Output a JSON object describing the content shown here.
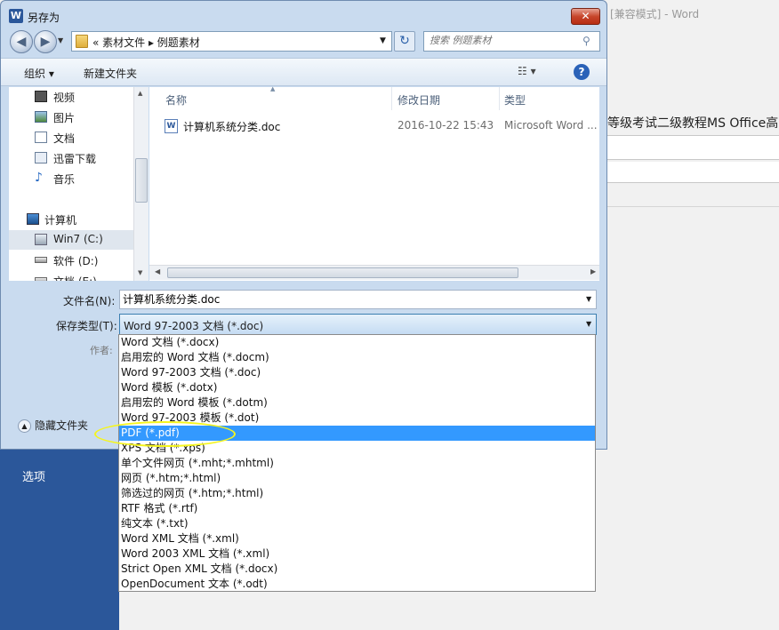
{
  "background_window": {
    "title": "[兼容模式] - Word",
    "doc_text": "等级考试二级教程MS Office高",
    "side_panel_label": "选项"
  },
  "dialog": {
    "title": "另存为",
    "app_icon_letter": "W",
    "close_glyph": "✕",
    "address": {
      "text": "«  素材文件  ▸  例题素材"
    },
    "search": {
      "placeholder": "搜索 例题素材"
    },
    "toolbar": {
      "organize": "组织 ▾",
      "new_folder": "新建文件夹",
      "view": "☷  ▾",
      "help": "?"
    },
    "nav_pane": {
      "items": [
        {
          "label": "视频",
          "icon": "video-icon"
        },
        {
          "label": "图片",
          "icon": "picture-icon"
        },
        {
          "label": "文档",
          "icon": "document-icon"
        },
        {
          "label": "迅雷下载",
          "icon": "download-icon"
        },
        {
          "label": "音乐",
          "icon": "music-icon"
        },
        {
          "label": "计算机",
          "icon": "computer-icon"
        },
        {
          "label": "Win7 (C:)",
          "icon": "drive-icon"
        },
        {
          "label": "软件 (D:)",
          "icon": "drive-icon"
        },
        {
          "label": "文档 (E:)",
          "icon": "drive-icon"
        }
      ]
    },
    "file_list": {
      "columns": [
        "名称",
        "修改日期",
        "类型"
      ],
      "rows": [
        {
          "name": "计算机系统分类.doc",
          "date": "2016-10-22 15:43",
          "type": "Microsoft Word ..."
        }
      ]
    },
    "filename": {
      "label": "文件名(N):",
      "value": "计算机系统分类.doc"
    },
    "filetype": {
      "label": "保存类型(T):",
      "selected": "Word 97-2003 文档 (*.doc)",
      "options": [
        "Word 文档 (*.docx)",
        "启用宏的 Word 文档 (*.docm)",
        "Word 97-2003 文档 (*.doc)",
        "Word 模板 (*.dotx)",
        "启用宏的 Word 模板 (*.dotm)",
        "Word 97-2003 模板 (*.dot)",
        "PDF (*.pdf)",
        "XPS 文档 (*.xps)",
        "单个文件网页 (*.mht;*.mhtml)",
        "网页 (*.htm;*.html)",
        "筛选过的网页 (*.htm;*.html)",
        "RTF 格式 (*.rtf)",
        "纯文本 (*.txt)",
        "Word XML 文档 (*.xml)",
        "Word 2003 XML 文档 (*.xml)",
        "Strict Open XML 文档 (*.docx)",
        "OpenDocument 文本 (*.odt)"
      ],
      "highlighted_option": "PDF (*.pdf)"
    },
    "author_label": "作者:",
    "hide_folders": "隐藏文件夹"
  },
  "colors": {
    "highlight": "#3399ff",
    "annotation_ellipse": "#f5f51e",
    "side_panel": "#2b579a"
  }
}
